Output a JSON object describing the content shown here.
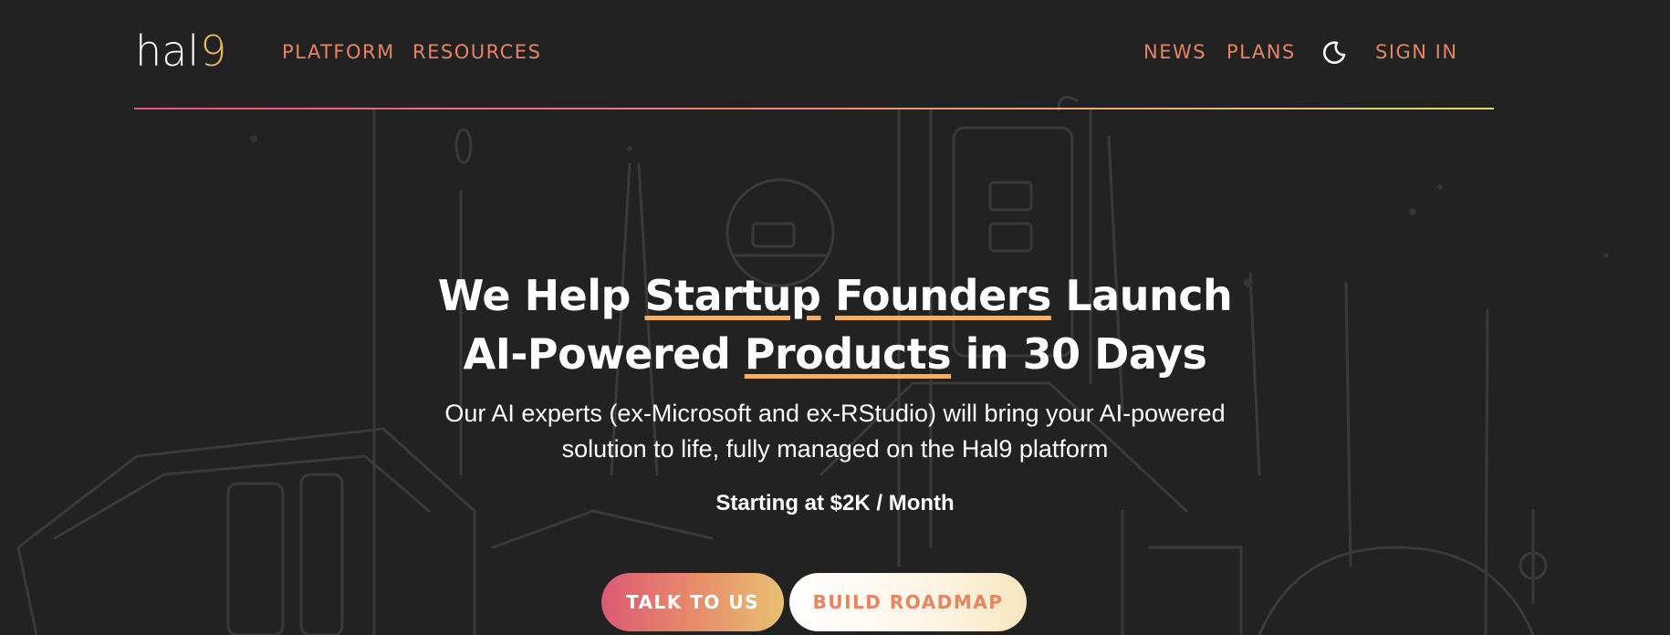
{
  "brand": {
    "name_main": "hal",
    "name_accent": "9"
  },
  "nav": {
    "left": [
      {
        "label": "PLATFORM"
      },
      {
        "label": "RESOURCES"
      }
    ],
    "right": [
      {
        "label": "NEWS"
      },
      {
        "label": "PLANS"
      }
    ],
    "theme_icon": "moon-icon",
    "sign_in": "SIGN IN"
  },
  "hero": {
    "line1": {
      "a": "We Help ",
      "b": "Startup",
      "c": " ",
      "d": "Founders",
      "e": " Launch"
    },
    "line2": {
      "a": "AI-Powered ",
      "b": "Products",
      "c": " in 30 Days"
    },
    "subtitle_1": "Our AI experts (ex-Microsoft and ex-RStudio) will bring your AI-powered",
    "subtitle_2": "solution to life, fully managed on the Hal9 platform",
    "pricing": "Starting at $2K / Month"
  },
  "cta": {
    "primary": "TALK TO US",
    "secondary": "BUILD ROADMAP"
  },
  "colors": {
    "accent": "#e8845e",
    "underline": "#f2b06a",
    "logo_accent": "#f2b65c",
    "background": "#222222"
  }
}
